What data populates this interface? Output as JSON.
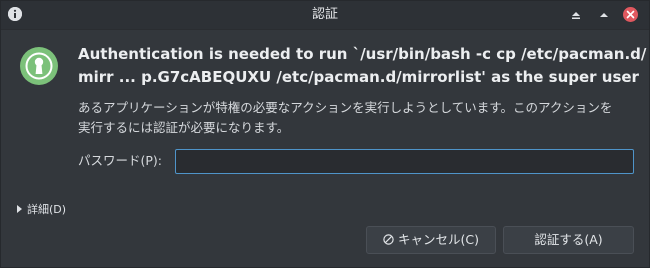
{
  "window": {
    "title": "認証"
  },
  "message": {
    "heading_line1": "Authentication is needed to run `/usr/bin/bash -c cp /etc/pacman.d/",
    "heading_line2": "mirr ... p.G7cABEQUXU /etc/pacman.d/mirrorlist' as the super user",
    "description_line1": "あるアプリケーションが特権の必要なアクションを実行しようとしています。このアクションを",
    "description_line2": "実行するには認証が必要になります。"
  },
  "password": {
    "label": "パスワード(P):",
    "value": "",
    "placeholder": ""
  },
  "details": {
    "label": "詳細(D)"
  },
  "buttons": {
    "cancel_label": "キャンセル(C)",
    "authenticate_label": "認証する(A)"
  },
  "icons": {
    "app": "info-icon",
    "auth": "keyhole-icon",
    "minimize": "minimize-icon",
    "maximize": "maximize-icon",
    "close": "close-icon",
    "cancel": "cancel-icon",
    "details": "expand-arrow-icon"
  },
  "colors": {
    "auth_icon": "#7cc17a",
    "close_button": "#e0585f",
    "input_focus": "#4f94c9"
  }
}
